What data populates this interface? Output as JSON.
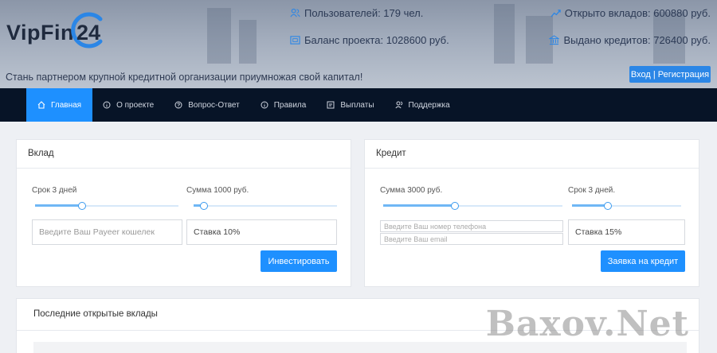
{
  "brand": {
    "name": "VipFin",
    "number": "24"
  },
  "stats": {
    "users": "Пользователей: 179 чел.",
    "balance": "Баланс проекта: 1028600 руб.",
    "deposits_open": "Открыто вкладов: 600880 руб.",
    "credits_issued": "Выдано кредитов: 726400 руб."
  },
  "tagline": "Стань партнером крупной кредитной организации приумножая свой капитал!",
  "login_label": "Вход | Регистрация",
  "nav": [
    {
      "label": "Главная",
      "icon": "home-icon",
      "active": true
    },
    {
      "label": "О проекте",
      "icon": "info-icon"
    },
    {
      "label": "Вопрос-Ответ",
      "icon": "question-icon"
    },
    {
      "label": "Правила",
      "icon": "info-icon"
    },
    {
      "label": "Выплаты",
      "icon": "payout-icon"
    },
    {
      "label": "Поддержка",
      "icon": "support-icon"
    }
  ],
  "deposit": {
    "title": "Вклад",
    "term_label": "Срок 3 дней",
    "term_level": 0.33,
    "amount_label": "Сумма 1000 руб.",
    "amount_level": 0.07,
    "wallet_placeholder": "Введите Ваш Payeer кошелек",
    "rate": "Ставка 10%",
    "invest_label": "Инвестировать"
  },
  "credit": {
    "title": "Кредит",
    "amount_label": "Сумма 3000 руб.",
    "amount_level": 0.4,
    "term_label": "Срок 3 дней.",
    "term_level": 0.33,
    "phone_placeholder": "Введите Ваш номер телефона",
    "email_placeholder": "Введите Ваш email",
    "rate": "Ставка 15%",
    "apply_label": "Заявка на кредит"
  },
  "recent_title": "Последние открытые вклады",
  "watermark": "Baxov.Net",
  "colors": {
    "accent": "#1e90ff",
    "nav_bg": "#071427",
    "logo_ring": "#2b86e6"
  }
}
